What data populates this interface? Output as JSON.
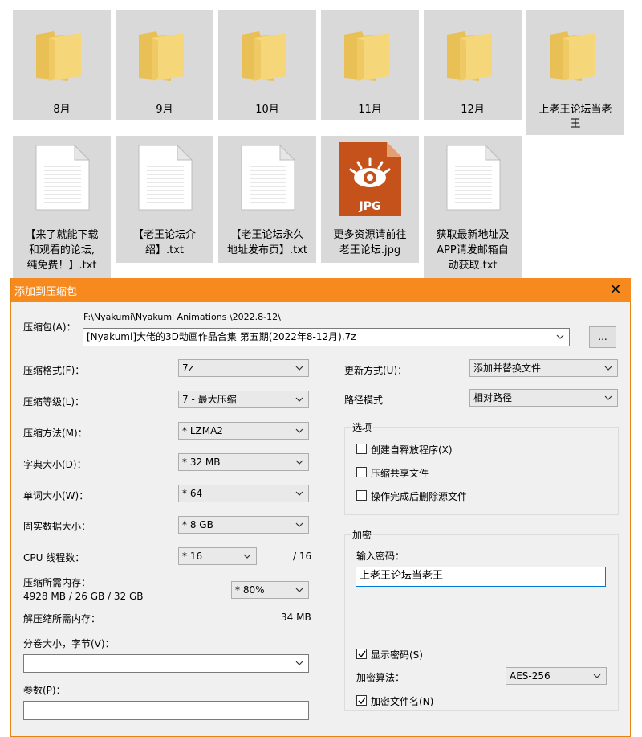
{
  "explorer": {
    "folders": [
      {
        "label": "8月"
      },
      {
        "label": "9月"
      },
      {
        "label": "10月"
      },
      {
        "label": "11月"
      },
      {
        "label": "12月"
      },
      {
        "label_line1": "上老王论坛当老",
        "label_line2": "王"
      }
    ],
    "files": [
      {
        "line1": "【来了就能下载",
        "line2": "和观看的论坛,",
        "line3": "纯免费！】.txt"
      },
      {
        "line1": "【老王论坛介",
        "line2": "绍】.txt"
      },
      {
        "line1": "【老王论坛永久",
        "line2": "地址发布页】.txt"
      },
      {
        "line1": "更多资源请前往",
        "line2": "老王论坛.jpg",
        "badge": "JPG"
      },
      {
        "line1": "获取最新地址及",
        "line2": "APP请发邮箱自",
        "line3": "动获取.txt"
      }
    ]
  },
  "dialog": {
    "title": "添加到压缩包",
    "close_glyph": "✕",
    "archive_label": "压缩包(A)：",
    "archive_path": "F:\\Nyakumi\\Nyakumi Animations \\2022.8-12\\",
    "archive_name": "[Nyakumi]大佬的3D动画作品合集 第五期(2022年8-12月).7z",
    "browse_label": "...",
    "format_label": "压缩格式(F)：",
    "format_value": "7z",
    "level_label": "压缩等级(L)：",
    "level_value": "7 - 最大压缩",
    "method_label": "压缩方法(M)：",
    "method_value": "* LZMA2",
    "dict_label": "字典大小(D)：",
    "dict_value": "* 32 MB",
    "word_label": "单词大小(W)：",
    "word_value": "* 64",
    "solid_label": "固实数据大小：",
    "solid_value": "* 8 GB",
    "threads_label": "CPU 线程数：",
    "threads_value": "* 16",
    "threads_max": "/ 16",
    "mem_label": "压缩所需内存：",
    "mem_detail": "4928 MB / 26 GB / 32 GB",
    "mem_percent": "* 80%",
    "decomp_label": "解压缩所需内存：",
    "decomp_value": "34 MB",
    "volume_label": "分卷大小，字节(V)：",
    "volume_value": "",
    "params_label": "参数(P)：",
    "params_value": "",
    "update_label": "更新方式(U)：",
    "update_value": "添加并替换文件",
    "path_mode_label": "路径模式",
    "path_mode_value": "相对路径",
    "options_title": "选项",
    "options": [
      {
        "label": "创建自释放程序(X)",
        "checked": false
      },
      {
        "label": "压缩共享文件",
        "checked": false
      },
      {
        "label": "操作完成后删除源文件",
        "checked": false
      }
    ],
    "encrypt_title": "加密",
    "password_label": "输入密码：",
    "password_value": "上老王论坛当老王",
    "show_password_label": "显示密码(S)",
    "enc_method_label": "加密算法：",
    "enc_method_value": "AES-256",
    "encrypt_names_label": "加密文件名(N)"
  },
  "colors": {
    "titlebar": "#f78a1f",
    "tile_bg": "#d9d9d9",
    "folder": "#f5d77a",
    "dialog_bg": "#f0f0f0",
    "focus": "#0078d7",
    "jpg_icon": "#c4521a"
  },
  "icons": {
    "folder": "folder-icon",
    "text_file": "text-file-icon",
    "jpg_file": "jpg-file-icon",
    "close": "close-icon",
    "dropdown": "chevron-down-icon",
    "checkbox": "checkmark-icon"
  }
}
